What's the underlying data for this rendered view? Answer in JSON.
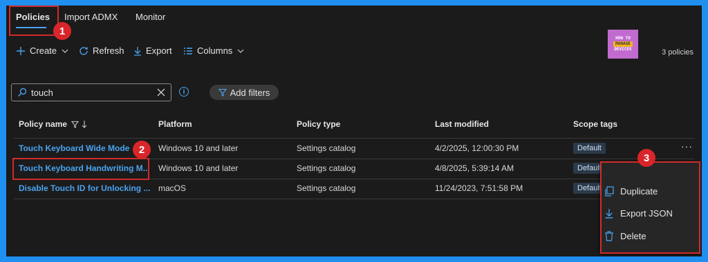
{
  "tabs": [
    {
      "label": "Policies",
      "active": true
    },
    {
      "label": "Import ADMX",
      "active": false
    },
    {
      "label": "Monitor",
      "active": false
    }
  ],
  "toolbar": {
    "create": "Create",
    "refresh": "Refresh",
    "export": "Export",
    "columns": "Columns"
  },
  "logo": {
    "line1": "HOW TO",
    "line2": "MANAGE",
    "line3": "DEVICES"
  },
  "policy_count": "3 policies",
  "search": {
    "value": "touch"
  },
  "add_filters": "Add filters",
  "info_icon": "i",
  "columns": {
    "name": "Policy name",
    "platform": "Platform",
    "type": "Policy type",
    "modified": "Last modified",
    "scope": "Scope tags"
  },
  "rows": [
    {
      "name": "Touch Keyboard Wide Mode",
      "platform": "Windows 10 and later",
      "type": "Settings catalog",
      "modified": "4/2/2025, 12:00:30 PM",
      "scope": "Default"
    },
    {
      "name": "Touch Keyboard Handwriting M...",
      "platform": "Windows 10 and later",
      "type": "Settings catalog",
      "modified": "4/8/2025, 5:39:14 AM",
      "scope": "Default"
    },
    {
      "name": "Disable Touch ID for Unlocking ...",
      "platform": "macOS",
      "type": "Settings catalog",
      "modified": "11/24/2023, 7:51:58 PM",
      "scope": "Default"
    }
  ],
  "more": "···",
  "context_menu": {
    "duplicate": "Duplicate",
    "export_json": "Export JSON",
    "delete": "Delete"
  },
  "callouts": [
    "1",
    "2",
    "3"
  ],
  "colors": {
    "accent": "#4aa3f0",
    "highlight": "#d32a2a",
    "background": "#1b1b1b",
    "frame": "#1f8ff0"
  }
}
